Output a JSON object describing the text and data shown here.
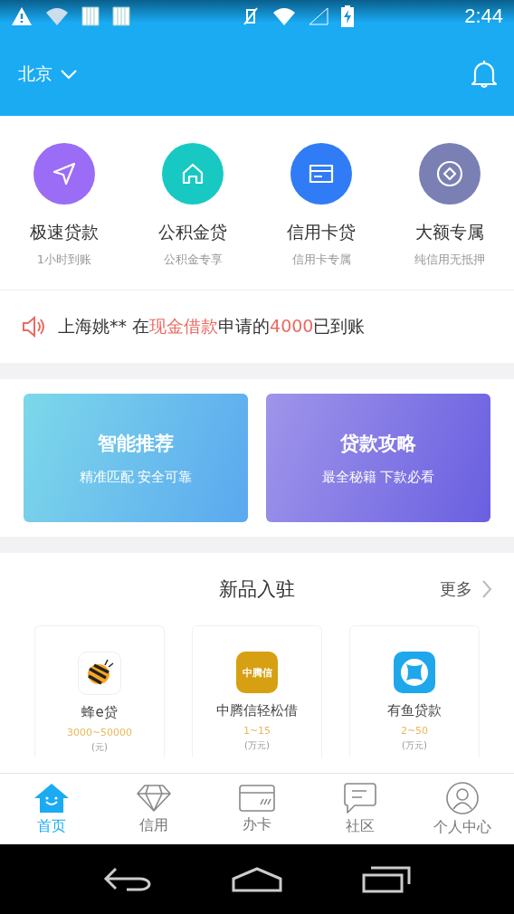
{
  "status_bar": {
    "time": "2:44"
  },
  "header": {
    "city": "北京"
  },
  "quick_entries": [
    {
      "label": "极速贷款",
      "sub": "1小时到账",
      "color": "#9b6cf5",
      "kind": "send"
    },
    {
      "label": "公积金贷",
      "sub": "公积金专享",
      "color": "#17c9c2",
      "kind": "home"
    },
    {
      "label": "信用卡贷",
      "sub": "信用卡专属",
      "color": "#2f7cf6",
      "kind": "card"
    },
    {
      "label": "大额专属",
      "sub": "纯信用无抵押",
      "color": "#7a80b3",
      "kind": "coin"
    }
  ],
  "notice": {
    "parts": [
      {
        "text": "上海姚** 在",
        "highlight": false
      },
      {
        "text": "现金借款",
        "highlight": true
      },
      {
        "text": "申请的",
        "highlight": false
      },
      {
        "text": "4000",
        "highlight": true
      },
      {
        "text": "已到账",
        "highlight": false
      }
    ]
  },
  "banners": [
    {
      "title": "智能推荐",
      "sub": "精准匹配 安全可靠",
      "kind": "teal"
    },
    {
      "title": "贷款攻略",
      "sub": "最全秘籍 下款必看",
      "kind": "violet"
    }
  ],
  "new_products": {
    "title": "新品入驻",
    "more": "更多",
    "items": [
      {
        "name": "蜂e贷",
        "range": "3000~50000",
        "unit": "(元)",
        "kind": "bee"
      },
      {
        "name": "中腾信轻松借",
        "range": "1~15",
        "unit": "(万元)",
        "kind": "badge",
        "logo_text": "中腾信"
      },
      {
        "name": "有鱼贷款",
        "range": "2~50",
        "unit": "(万元)",
        "kind": "star"
      }
    ]
  },
  "tabs": [
    {
      "label": "首页",
      "selected": true,
      "kind": "home"
    },
    {
      "label": "信用",
      "selected": false,
      "kind": "diamond"
    },
    {
      "label": "办卡",
      "selected": false,
      "kind": "card"
    },
    {
      "label": "社区",
      "selected": false,
      "kind": "chat"
    },
    {
      "label": "个人中心",
      "selected": false,
      "kind": "person"
    }
  ]
}
